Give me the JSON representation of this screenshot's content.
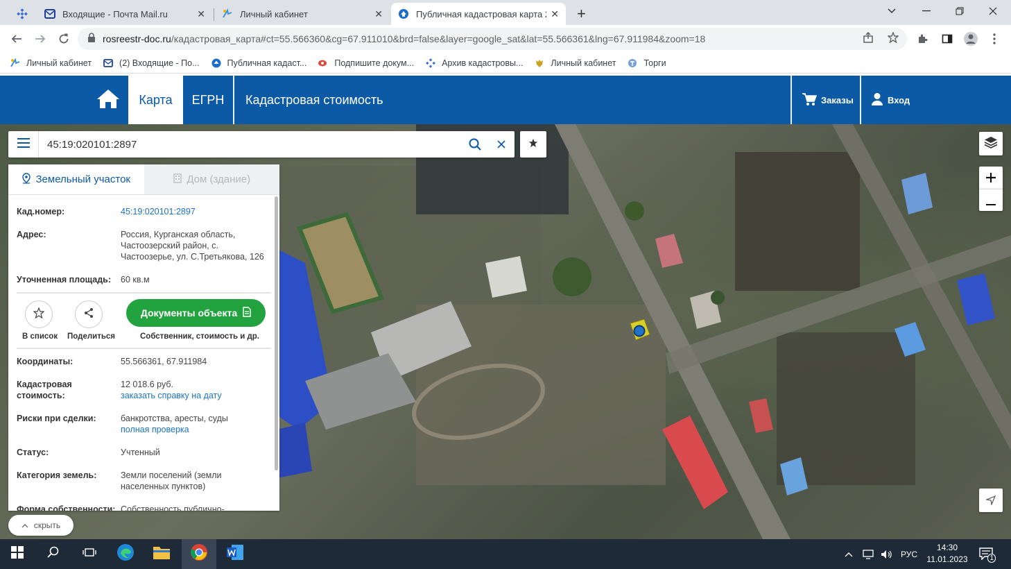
{
  "browser": {
    "tabs": [
      {
        "title": "Входящие - Почта Mail.ru",
        "icon": "mail-icon"
      },
      {
        "title": "Личный кабинет",
        "icon": "gosuslugi-icon"
      },
      {
        "title": "Публичная кадастровая карта 2",
        "icon": "rosreestr-icon"
      }
    ],
    "new_tab_label": "+",
    "url_domain": "rosreestr-doc.ru",
    "url_path": "/кадастровая_карта#ct=55.566360&cg=67.911010&brd=false&layer=google_sat&lat=55.566361&lng=67.911984&zoom=18",
    "bookmarks": [
      {
        "label": "Личный кабинет"
      },
      {
        "label": "(2) Входящие - По..."
      },
      {
        "label": "Публичная кадаст..."
      },
      {
        "label": "Подпишите докум..."
      },
      {
        "label": "Архив кадастровы..."
      },
      {
        "label": "Личный кабинет"
      },
      {
        "label": "Торги"
      }
    ]
  },
  "site": {
    "nav": {
      "map": "Карта",
      "egrn": "ЕГРН",
      "cadastral_value": "Кадастровая стоимость"
    },
    "orders": "Заказы",
    "login": "Вход"
  },
  "search": {
    "value": "45:19:020101:2897"
  },
  "panel": {
    "tabs": {
      "land": "Земельный участок",
      "house": "Дом (здание)"
    },
    "cad_number_label": "Кад.номер:",
    "cad_number": "45:19:020101:2897",
    "address_label": "Адрес:",
    "address": "Россия, Курганская область, Частоозерский район, с. Частоозерье, ул. С.Третьякова, 126",
    "area_label": "Уточненная площадь:",
    "area": "60 кв.м",
    "add_to_list": "В список",
    "share": "Поделиться",
    "documents_button": "Документы объекта",
    "documents_sub": "Собственник, стоимость и др.",
    "coords_label": "Координаты:",
    "coords": "55.566361, 67.911984",
    "cad_value_label": "Кадастровая стоимость:",
    "cad_value": "12 018.6 руб.",
    "cad_value_link": "заказать справку на дату",
    "risks_label": "Риски при сделки:",
    "risks": "банкротства, аресты, суды",
    "risks_link": "полная проверка",
    "status_label": "Статус:",
    "status": "Учтенный",
    "category_label": "Категория земель:",
    "category": "Земли поселений (земли населенных пунктов)",
    "ownership_label": "Форма собственности:",
    "ownership": "Собственность публично-"
  },
  "hide_button": "скрыть",
  "taskbar": {
    "lang": "РУС",
    "time": "14:30",
    "date": "11.01.2023",
    "notifications": "1"
  }
}
